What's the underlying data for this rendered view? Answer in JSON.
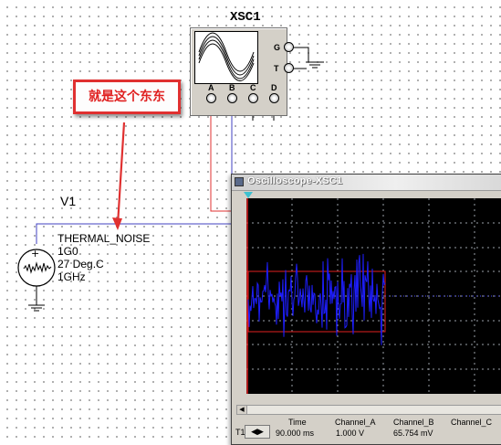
{
  "instrument": {
    "title": "XSC1",
    "terminals": {
      "ground": "G",
      "trigger": "T",
      "channels": [
        "A",
        "B",
        "C",
        "D"
      ]
    }
  },
  "callout": {
    "text": "就是这个东东"
  },
  "source": {
    "ref": "V1",
    "params": [
      "THERMAL_NOISE",
      "1G0",
      "27 Deg.C",
      "1GHz"
    ]
  },
  "oscilloscope_window": {
    "title": "Oscilloscope-XSC1",
    "readout": {
      "row_label": "T1",
      "headers": [
        "Time",
        "Channel_A",
        "Channel_B",
        "Channel_C"
      ],
      "values": [
        "90.000 ms",
        "1.000 V",
        "65.754 mV",
        ""
      ]
    }
  },
  "colors": {
    "wire_red": "#e03030",
    "wire_blue": "#4040c0",
    "trace_blue": "#1e1eff",
    "trace_red": "#e02020",
    "screen_grid": "#9aa0a8",
    "trigger_marker": "#3fc1d0"
  }
}
